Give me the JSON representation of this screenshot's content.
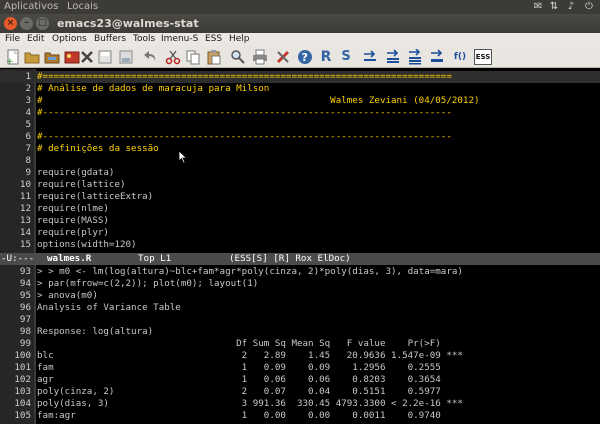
{
  "top_panel": {
    "menus": [
      "Aplicativos",
      "Locais"
    ],
    "tray_icons": [
      "mail-icon",
      "network-icon",
      "volume-icon",
      "power-icon"
    ]
  },
  "window": {
    "title": "emacs23@walmes-stat",
    "close_glyph": "×",
    "min_glyph": "–",
    "max_glyph": "□"
  },
  "menubar": {
    "items": [
      "File",
      "Edit",
      "Options",
      "Buffers",
      "Tools",
      "Imenu-S",
      "ESS",
      "Help"
    ]
  },
  "toolbar": {
    "icons": [
      "new-file-icon",
      "open-folder-icon",
      "open-dired-icon",
      "close-buffer-icon",
      "save-icon",
      "save-as-icon",
      "undo-icon",
      "cut-icon",
      "copy-icon",
      "paste-icon",
      "search-icon",
      "print-icon",
      "preferences-icon",
      "help-icon",
      "r-icon",
      "sweave-icon",
      "eval-line-icon",
      "eval-region-icon",
      "eval-buffer-icon",
      "eval-function-icon",
      "ess-icon"
    ],
    "labels": {
      "r": "R",
      "sweave": "S",
      "fo": "f()",
      "ess": "ESS"
    }
  },
  "source_buffer": {
    "lines": [
      {
        "n": "1",
        "text": "#==========================================================================",
        "kind": "comment"
      },
      {
        "n": "2",
        "text": "# Análise de dados de maracuja para Milson",
        "kind": "comment"
      },
      {
        "n": "3",
        "text": "#                                                    Walmes Zeviani (04/05/2012)",
        "kind": "comment"
      },
      {
        "n": "4",
        "text": "#--------------------------------------------------------------------------",
        "kind": "comment"
      },
      {
        "n": "5",
        "text": "",
        "kind": "code"
      },
      {
        "n": "6",
        "text": "#--------------------------------------------------------------------------",
        "kind": "comment"
      },
      {
        "n": "7",
        "text": "# definições da sessão",
        "kind": "comment"
      },
      {
        "n": "8",
        "text": "",
        "kind": "code"
      },
      {
        "n": "9",
        "text": "require(gdata)",
        "kind": "code"
      },
      {
        "n": "10",
        "text": "require(lattice)",
        "kind": "code"
      },
      {
        "n": "11",
        "text": "require(latticeExtra)",
        "kind": "code"
      },
      {
        "n": "12",
        "text": "require(nlme)",
        "kind": "code"
      },
      {
        "n": "13",
        "text": "require(MASS)",
        "kind": "code"
      },
      {
        "n": "14",
        "text": "require(plyr)",
        "kind": "code"
      },
      {
        "n": "15",
        "text": "options(width=120)",
        "kind": "code"
      }
    ]
  },
  "modeline": {
    "status": "-U:---",
    "buffer": "walmes.R",
    "position": "Top L1",
    "modes": "(ESS[S] [R] Rox ElDoc)"
  },
  "console_buffer": {
    "lines": [
      {
        "n": "93",
        "text": "> > m0 <- lm(log(altura)~blc+fam*agr*poly(cinza, 2)*poly(dias, 3), data=mara)"
      },
      {
        "n": "94",
        "text": "> par(mfrow=c(2,2)); plot(m0); layout(1)"
      },
      {
        "n": "95",
        "text": "> anova(m0)"
      },
      {
        "n": "96",
        "text": "Analysis of Variance Table"
      },
      {
        "n": "97",
        "text": ""
      },
      {
        "n": "98",
        "text": "Response: log(altura)"
      },
      {
        "n": "99",
        "text": "                                    Df Sum Sq Mean Sq   F value    Pr(>F)"
      },
      {
        "n": "100",
        "text": "blc                                  2   2.89    1.45   20.9636 1.547e-09 ***"
      },
      {
        "n": "101",
        "text": "fam                                  1   0.09    0.09    1.2956    0.2555"
      },
      {
        "n": "102",
        "text": "agr                                  1   0.06    0.06    0.8203    0.3654"
      },
      {
        "n": "103",
        "text": "poly(cinza, 2)                       2   0.07    0.04    0.5151    0.5977"
      },
      {
        "n": "104",
        "text": "poly(dias, 3)                        3 991.36  330.45 4793.3300 < 2.2e-16 ***"
      },
      {
        "n": "105",
        "text": "fam:agr                              1   0.00    0.00    0.0011    0.9740"
      }
    ]
  }
}
